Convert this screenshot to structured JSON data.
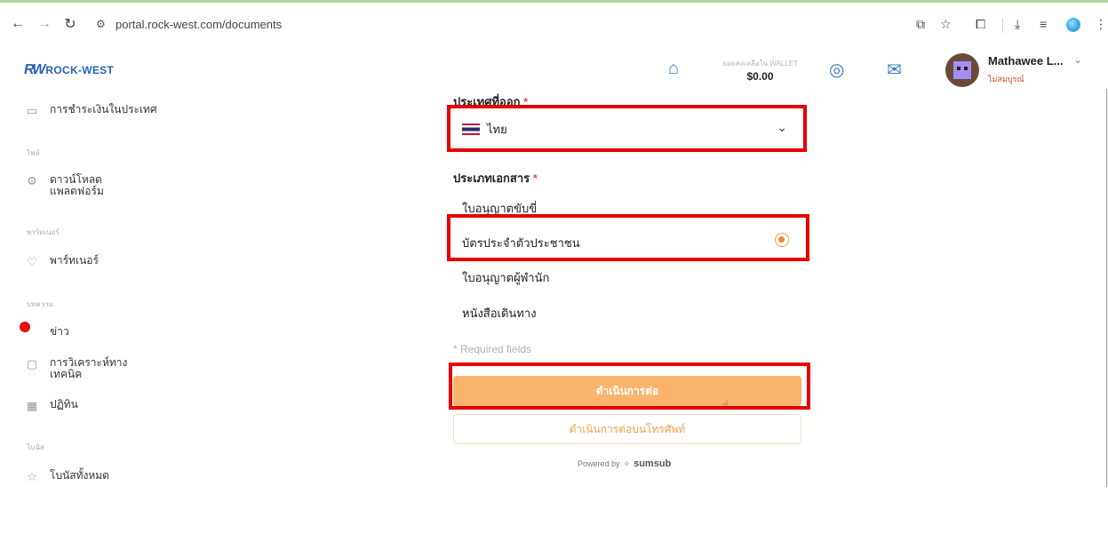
{
  "browser": {
    "url": "portal.rock-west.com/documents"
  },
  "header": {
    "logo_mark": "RW",
    "logo_text": "ROCK-WEST",
    "wallet_label": "ยอดคงเหลือใน WALLET",
    "wallet_amount": "$0.00",
    "user_name": "Mathawee L...",
    "user_status": "ไม่สมบูรณ์"
  },
  "sidebar": {
    "items": [
      {
        "label": "การชำระเงินในประเทศ"
      },
      {
        "head": "ไฟล์"
      },
      {
        "label": "ดาวน์โหลด\nแพลตฟอร์ม"
      },
      {
        "head": "พาร์ทเนอร์"
      },
      {
        "label": "พาร์ทเนอร์"
      },
      {
        "head": "บทความ"
      },
      {
        "label": "ข่าว"
      },
      {
        "label": "การวิเคราะห์ทาง\nเทคนิค"
      },
      {
        "label": "ปฏิทิน"
      },
      {
        "head": "โบนัส"
      },
      {
        "label": "โบนัสทั้งหมด"
      }
    ]
  },
  "form": {
    "country_label": "ประเทศที่ออก",
    "required_mark": "*",
    "country_value": "ไทย",
    "doc_type_label": "ประเภทเอกสาร",
    "options": [
      {
        "label": "ใบอนุญาตขับขี่",
        "selected": false
      },
      {
        "label": "บัตรประจำตัวประชาชน",
        "selected": true
      },
      {
        "label": "ใบอนุญาตผู้พำนัก",
        "selected": false
      },
      {
        "label": "หนังสือเดินทาง",
        "selected": false
      }
    ],
    "required_note": "* Required fields",
    "continue_label": "ดำเนินการต่อ",
    "continue_phone_label": "ดำเนินการต่อบนโทรศัพท์",
    "powered_by": "Powered by",
    "powered_brand": "sumsub"
  },
  "colors": {
    "accent": "#f9b36d",
    "brand": "#2a61b8",
    "highlight": "#e60000"
  }
}
